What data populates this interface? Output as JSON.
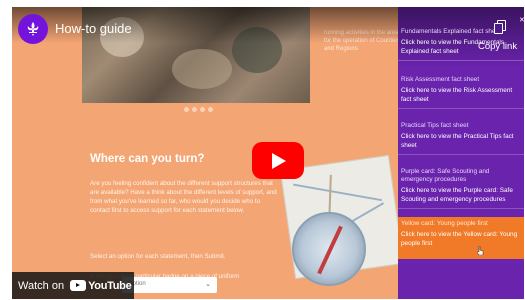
{
  "video": {
    "title": "How-to guide",
    "watch_label": "Watch on",
    "youtube_word": "YouTube",
    "headline": "Where can you turn?",
    "paragraph": "Are you feeling confident about the different support structures that are available? Have a think about the different levels of support, and from what you've learned so far, who would you decide who to contact first to access support for each statement below.",
    "instruction": "Select an option for each statement, then Submit.",
    "statement": "A Young Leader particular badge on a piece of uniform",
    "select_value": "Option",
    "side_text": "running activities in the area for the operation of Counties and Regions"
  },
  "sidebar": {
    "copy_label": "Copy link",
    "items": [
      {
        "title": "Fundamentals Explained fact sheet",
        "desc": "Click here to view the Fundamentals Explained fact sheet"
      },
      {
        "title": "Risk Assessment fact sheet",
        "desc": "Click here to view the Risk Assessment fact sheet"
      },
      {
        "title": "Practical Tips fact sheet",
        "desc": "Click here to view the Practical Tips fact sheet"
      },
      {
        "title": "Purple card: Safe Scouting and emergency procedures",
        "desc": "Click here to view the Purple card: Safe Scouting and emergency procedures"
      },
      {
        "title": "Yellow card: Young people first",
        "desc": "Click here to view the Yellow card: Young people first"
      }
    ]
  },
  "colors": {
    "brand_purple": "#7413dc",
    "sidebar_purple": "#6a23ad",
    "active_orange": "#f07a28",
    "page_orange": "#f4a574",
    "youtube_red": "#ff0000"
  },
  "icons": [
    "scouts-logo-icon",
    "play-icon",
    "youtube-logo-icon",
    "copy-icon",
    "close-icon",
    "cursor-icon",
    "chevron-down-icon"
  ]
}
